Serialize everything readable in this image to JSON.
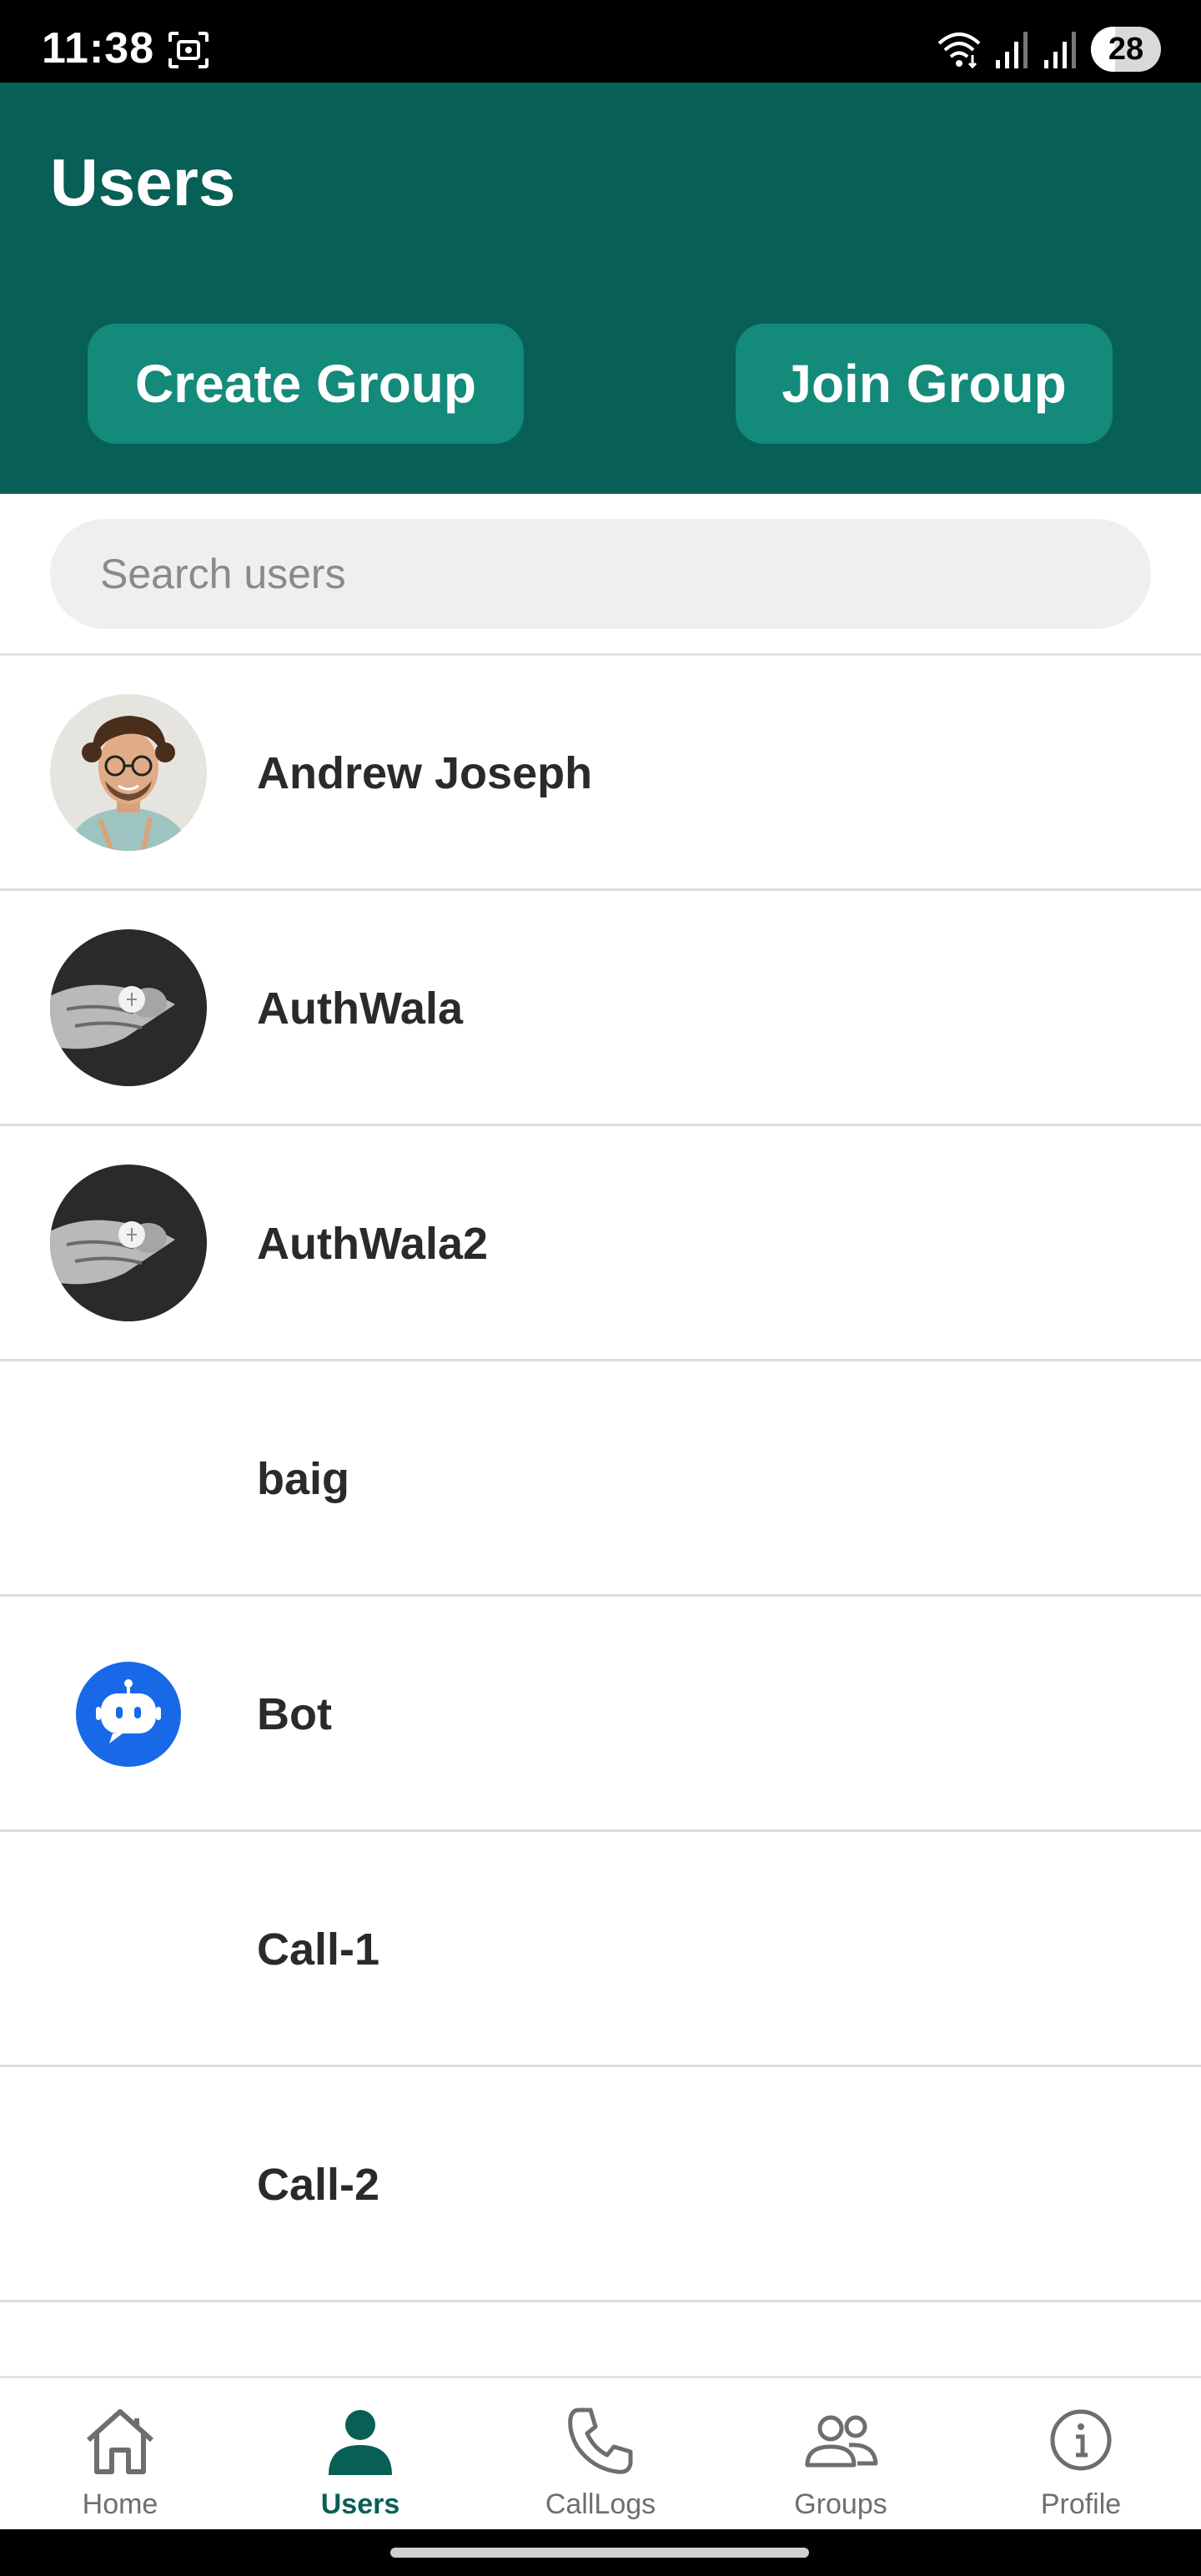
{
  "status_bar": {
    "time": "11:38",
    "battery_level": "28"
  },
  "header": {
    "title": "Users",
    "create_group_label": "Create Group",
    "join_group_label": "Join Group",
    "background_color": "#085f56",
    "button_color": "#138a7a"
  },
  "search": {
    "placeholder": "Search users",
    "value": ""
  },
  "users": [
    {
      "name": "Andrew Joseph",
      "avatar": "photo-portrait"
    },
    {
      "name": "AuthWala",
      "avatar": "photo-hand-coin"
    },
    {
      "name": "AuthWala2",
      "avatar": "photo-hand-coin"
    },
    {
      "name": "baig",
      "avatar": "none"
    },
    {
      "name": "Bot",
      "avatar": "robot-icon"
    },
    {
      "name": "Call-1",
      "avatar": "none"
    },
    {
      "name": "Call-2",
      "avatar": "none"
    }
  ],
  "bottom_nav": {
    "active": "Users",
    "active_color": "#085f56",
    "items": [
      {
        "label": "Home",
        "icon": "home-icon"
      },
      {
        "label": "Users",
        "icon": "user-icon"
      },
      {
        "label": "CallLogs",
        "icon": "phone-icon"
      },
      {
        "label": "Groups",
        "icon": "groups-icon"
      },
      {
        "label": "Profile",
        "icon": "info-icon"
      }
    ]
  }
}
